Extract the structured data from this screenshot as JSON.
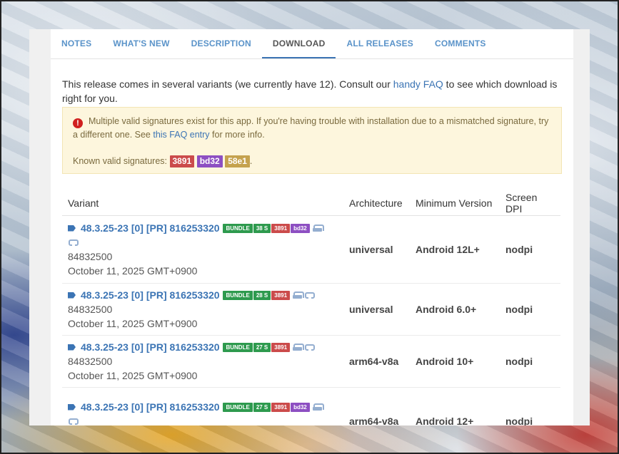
{
  "tabs": [
    {
      "label": "NOTES"
    },
    {
      "label": "WHAT'S NEW"
    },
    {
      "label": "DESCRIPTION"
    },
    {
      "label": "DOWNLOAD"
    },
    {
      "label": "ALL RELEASES"
    },
    {
      "label": "COMMENTS"
    }
  ],
  "active_tab": "DOWNLOAD",
  "intro": {
    "text_before": "This release comes in several variants (we currently have 12). Consult our ",
    "link": "handy FAQ",
    "text_after": " to see which download is right for you."
  },
  "alert": {
    "icon": "exclamation-circle-icon",
    "text_before": "Multiple valid signatures exist for this app. If you're having trouble with installation due to a mismatched signature, try a different one. See ",
    "link": "this FAQ entry",
    "text_after": " for more info.",
    "signatures_label": "Known valid signatures: ",
    "signatures": [
      {
        "label": "3891",
        "color": "#cb4b4b"
      },
      {
        "label": "bd32",
        "color": "#8d4fc2"
      },
      {
        "label": "58e1",
        "color": "#c5a24e"
      }
    ],
    "trailing": "."
  },
  "table": {
    "headers": [
      "Variant",
      "Architecture",
      "Minimum Version",
      "Screen DPI"
    ],
    "rows": [
      {
        "name": "48.3.25-23 [0] [PR] 816253320",
        "badges": [
          "BUNDLE",
          "38 S",
          "3891",
          "bd32"
        ],
        "code": "84832500",
        "date": "October 11, 2025 GMT+0900",
        "arch": "universal",
        "minv": "Android 12L+",
        "dpi": "nodpi"
      },
      {
        "name": "48.3.25-23 [0] [PR] 816253320",
        "badges": [
          "BUNDLE",
          "28 S",
          "3891"
        ],
        "code": "84832500",
        "date": "October 11, 2025 GMT+0900",
        "arch": "universal",
        "minv": "Android 6.0+",
        "dpi": "nodpi"
      },
      {
        "name": "48.3.25-23 [0] [PR] 816253320",
        "badges": [
          "BUNDLE",
          "27 S",
          "3891"
        ],
        "code": "84832500",
        "date": "October 11, 2025 GMT+0900",
        "arch": "arm64-v8a",
        "minv": "Android 10+",
        "dpi": "nodpi"
      },
      {
        "name": "48.3.25-23 [0] [PR] 816253320",
        "badges": [
          "BUNDLE",
          "27 S",
          "3891",
          "bd32"
        ],
        "code": "",
        "date": "",
        "arch": "arm64-v8a",
        "minv": "Android 12+",
        "dpi": "nodpi"
      }
    ]
  },
  "colors": {
    "link": "#3b74b4",
    "bundle_badge": "#2e9a4e",
    "sig_3891": "#cb4b4b",
    "sig_bd32": "#8d4fc2",
    "sig_58e1": "#c5a24e",
    "alert_bg": "#fdf6dd"
  }
}
